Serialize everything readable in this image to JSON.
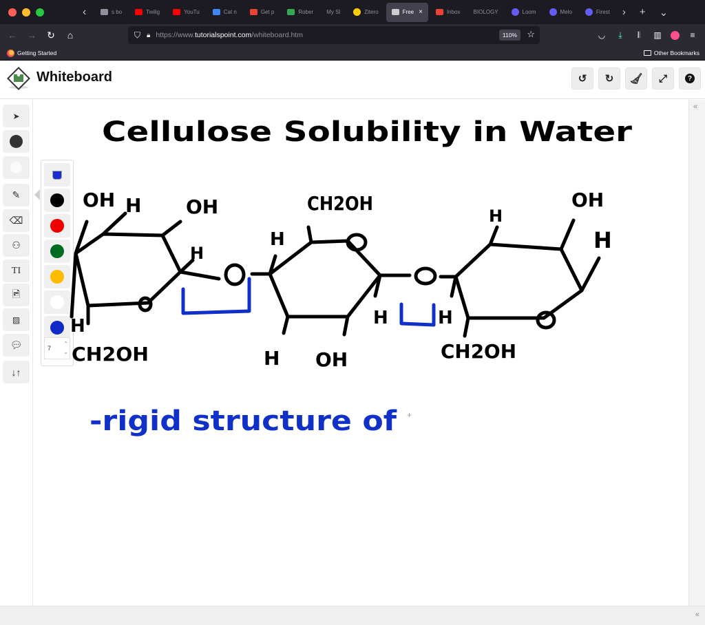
{
  "browser": {
    "traffic_colors": [
      "#ff5f57",
      "#febc2e",
      "#28c840"
    ],
    "tabs": [
      {
        "label": "s bo",
        "favicon": "bookmark",
        "color": "#8f8f9d",
        "active": false
      },
      {
        "label": "Twilig",
        "favicon": "youtube-icon",
        "color": "#ff0000",
        "active": false
      },
      {
        "label": "YouTu",
        "favicon": "youtube-icon",
        "color": "#ff0000",
        "active": false
      },
      {
        "label": "Cat n",
        "favicon": "docs-icon",
        "color": "#4285f4",
        "active": false
      },
      {
        "label": "Get p",
        "favicon": "gmail-icon",
        "color": "#ea4335",
        "active": false
      },
      {
        "label": "Rober",
        "favicon": "drive-icon",
        "color": "#34a853",
        "active": false
      },
      {
        "label": "My Sl",
        "favicon": "none",
        "color": "",
        "active": false
      },
      {
        "label": "Zitero",
        "favicon": "zotero-icon",
        "color": "#ffcc00",
        "active": false
      },
      {
        "label": "Free",
        "favicon": "tutorialspoint-icon",
        "color": "#cccccc",
        "active": true
      },
      {
        "label": "Inbox",
        "favicon": "gmail-icon",
        "color": "#ea4335",
        "active": false
      },
      {
        "label": "BIOLOGY",
        "favicon": "none",
        "color": "",
        "active": false
      },
      {
        "label": "Loom",
        "favicon": "loom-icon",
        "color": "#625df5",
        "active": false
      },
      {
        "label": "Melo",
        "favicon": "loom-icon",
        "color": "#625df5",
        "active": false
      },
      {
        "label": "Firest",
        "favicon": "loom-icon",
        "color": "#625df5",
        "active": false
      }
    ],
    "url_prefix": "https://www.",
    "url_domain": "tutorialspoint.com",
    "url_path": "/whiteboard.htm",
    "zoom_level": "110%",
    "bookmarks": {
      "left": "Getting Started",
      "right": "Other Bookmarks"
    }
  },
  "app": {
    "title": "Whiteboard",
    "header_buttons": [
      "undo",
      "redo",
      "clear",
      "fullscreen",
      "help"
    ],
    "help_glyph": "?"
  },
  "tools": [
    {
      "name": "select",
      "glyph": "➤"
    },
    {
      "name": "fill-color",
      "glyph": "●",
      "color": "#333333"
    },
    {
      "name": "background-color",
      "glyph": "●",
      "color": "#f4f4f4"
    },
    {
      "name": "pencil",
      "glyph": "✎"
    },
    {
      "name": "eraser",
      "glyph": "▱"
    },
    {
      "name": "shapes",
      "glyph": "⌬"
    },
    {
      "name": "text",
      "glyph": "TI"
    },
    {
      "name": "image",
      "glyph": "▣"
    },
    {
      "name": "presenter",
      "glyph": "⬚"
    },
    {
      "name": "comments",
      "glyph": "💬"
    },
    {
      "name": "sort",
      "glyph": "↓↑"
    }
  ],
  "palette": {
    "colors": [
      "#0018cc",
      "#000000",
      "#ee0000",
      "#006b1f",
      "#ffbb00",
      "#ffffff",
      "#1029c7"
    ],
    "current_color": "#1a2ecc",
    "stroke_size": "7"
  },
  "drawing": {
    "title": "Cellulose Solubility in Water",
    "note": "-rigid structure of",
    "ink_black": "#000000",
    "ink_blue": "#1030c8",
    "labels": {
      "r1_oh_top": "OH",
      "r1_h_top": "H",
      "r1_oh_right": "OH",
      "r1_h_mid": "H",
      "r1_h_bot": "H",
      "r1_ch2oh": "CH2OH",
      "r2_ch2oh": "CH2OH",
      "r2_h_left": "H",
      "r2_h_bot": "H",
      "r2_oh_bot": "OH",
      "r2_h_right": "H",
      "r3_h_top": "H",
      "r3_oh_top": "OH",
      "r3_h_right": "H",
      "r3_h_left": "H",
      "r3_ch2oh": "CH2OH",
      "bridge_o1": "O",
      "bridge_o2": "O"
    }
  }
}
